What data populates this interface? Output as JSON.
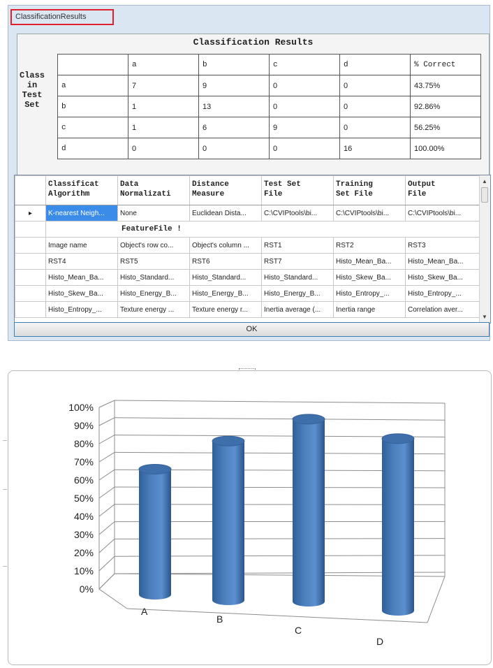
{
  "window": {
    "title": "ClassificationResults",
    "ok_label": "OK"
  },
  "results": {
    "title": "Classification Results",
    "side_label_lines": [
      "Class",
      "in",
      "Test",
      "Set"
    ],
    "columns": [
      "",
      "a",
      "b",
      "c",
      "d",
      "% Correct"
    ],
    "rows": [
      [
        "a",
        "7",
        "9",
        "0",
        "0",
        "43.75%"
      ],
      [
        "b",
        "1",
        "13",
        "0",
        "0",
        "92.86%"
      ],
      [
        "c",
        "1",
        "6",
        "9",
        "0",
        "56.25%"
      ],
      [
        "d",
        "0",
        "0",
        "0",
        "16",
        "100.00%"
      ]
    ]
  },
  "grid": {
    "headers": [
      [
        "Classificat",
        "Algorithm"
      ],
      [
        "Data",
        "Normalizati"
      ],
      [
        "Distance",
        "Measure"
      ],
      [
        "Test Set",
        "File"
      ],
      [
        "Training",
        "Set File"
      ],
      [
        "Output",
        "File"
      ]
    ],
    "current_row_marker": "▸",
    "row1": [
      "K-nearest Neigh...",
      "None",
      "Euclidean Dista...",
      "C:\\CVIPtools\\bi...",
      "C:\\CVIPtools\\bi...",
      "C:\\CVIPtools\\bi..."
    ],
    "feature_label": "FeatureFile !",
    "rows": [
      [
        "Image name",
        "Object's row co...",
        "Object's column ...",
        "RST1",
        "RST2",
        "RST3"
      ],
      [
        "RST4",
        "RST5",
        "RST6",
        "RST7",
        "Histo_Mean_Ba...",
        "Histo_Mean_Ba..."
      ],
      [
        "Histo_Mean_Ba...",
        "Histo_Standard...",
        "Histo_Standard...",
        "Histo_Standard...",
        "Histo_Skew_Ba...",
        "Histo_Skew_Ba..."
      ],
      [
        "Histo_Skew_Ba...",
        "Histo_Energy_B...",
        "Histo_Energy_B...",
        "Histo_Energy_B...",
        "Histo_Entropy_...",
        "Histo_Entropy_..."
      ],
      [
        "Histo_Entropy_...",
        "Texture energy ...",
        "Texture energy r...",
        "Inertia average (...",
        "Inertia range",
        "Correlation aver..."
      ]
    ]
  },
  "chart_data": {
    "type": "bar",
    "style": "3d-cylinder",
    "categories": [
      "A",
      "B",
      "C",
      "D"
    ],
    "values": [
      68,
      85,
      96,
      94
    ],
    "ylim": [
      0,
      100
    ],
    "yticks": [
      "0%",
      "10%",
      "20%",
      "30%",
      "40%",
      "50%",
      "60%",
      "70%",
      "80%",
      "90%",
      "100%"
    ],
    "grid": true,
    "bar_color": "#4a7ebb"
  }
}
